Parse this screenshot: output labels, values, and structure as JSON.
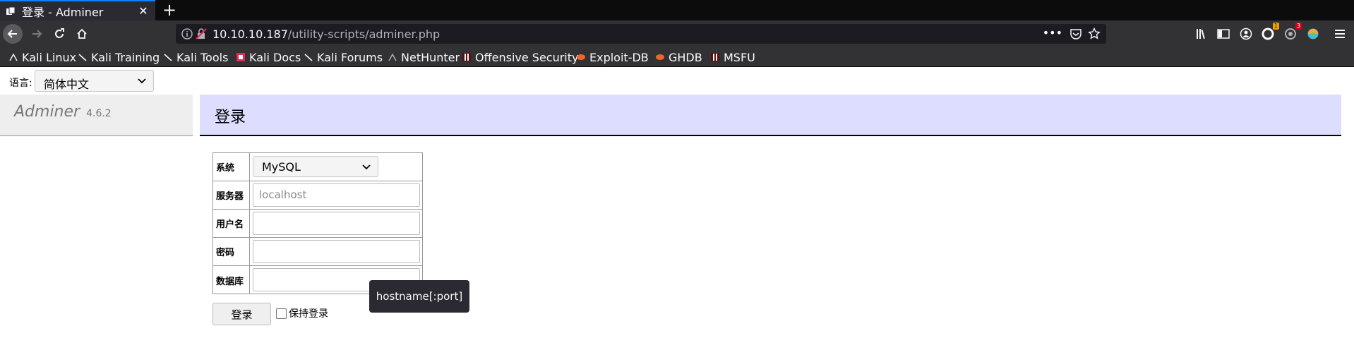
{
  "browser": {
    "tab_title": "登录 - Adminer",
    "url_host": "10.10.10.187",
    "url_path": "/utility-scripts/adminer.php",
    "url_more": "•••",
    "badge_1": "1",
    "badge_2": "3"
  },
  "bookmarks": [
    {
      "label": "Kali Linux",
      "icon": "kali-dragon-icon"
    },
    {
      "label": "Kali Training",
      "icon": "kali-dragon-icon"
    },
    {
      "label": "Kali Tools",
      "icon": "kali-dragon-icon"
    },
    {
      "label": "Kali Docs",
      "icon": "kali-docs-icon"
    },
    {
      "label": "Kali Forums",
      "icon": "kali-dragon-icon"
    },
    {
      "label": "NetHunter",
      "icon": "nethunter-icon"
    },
    {
      "label": "Offensive Security",
      "icon": "offsec-icon"
    },
    {
      "label": "Exploit-DB",
      "icon": "exploitdb-icon"
    },
    {
      "label": "GHDB",
      "icon": "ghdb-icon"
    },
    {
      "label": "MSFU",
      "icon": "msfu-icon"
    }
  ],
  "page": {
    "lang_label": "语言:",
    "lang_value": "简体中文",
    "brand": "Adminer",
    "version": "4.6.2",
    "heading": "登录",
    "form": {
      "system_label": "系统",
      "system_value": "MySQL",
      "server_label": "服务器",
      "server_placeholder": "localhost",
      "user_label": "用户名",
      "password_label": "密码",
      "database_label": "数据库"
    },
    "tooltip": "hostname[:port]",
    "login_button": "登录",
    "remember_label": "保持登录"
  },
  "colors": {
    "header_bg": "#ddddff",
    "sidebar_bg": "#eeeeee",
    "chrome_bg": "#323234",
    "accent": "#0a84ff"
  }
}
